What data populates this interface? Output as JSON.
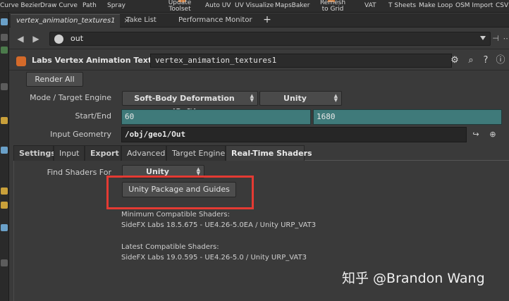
{
  "shelf": {
    "tools": [
      {
        "label": "Curve Bezier"
      },
      {
        "label": "Draw Curve"
      },
      {
        "label": "Path"
      },
      {
        "label": "Spray"
      },
      {
        "label": "Update Toolset"
      },
      {
        "label": "Auto UV"
      },
      {
        "label": "UV Visualize"
      },
      {
        "label": "MapsBaker"
      },
      {
        "label": "Remesh to Grid"
      },
      {
        "label": "VAT"
      },
      {
        "label": "T Sheets"
      },
      {
        "label": "Make Loop"
      },
      {
        "label": "OSM Import"
      },
      {
        "label": "CSV"
      }
    ]
  },
  "tabs": [
    {
      "label": "vertex_animation_textures1",
      "active": true,
      "close": "×"
    },
    {
      "label": "Take List"
    },
    {
      "label": "Performance Monitor"
    }
  ],
  "tab_add": "+",
  "pathbar": {
    "value": "out"
  },
  "node": {
    "type_label": "Labs Vertex Animation Textures",
    "name": "vertex_animation_textures1"
  },
  "params": {
    "render_all": "Render All",
    "mode_label": "Mode / Target Engine",
    "mode_value": "Soft-Body Deformation (Soft)",
    "engine_value": "Unity",
    "startend_label": "Start/End",
    "start": "60",
    "end": "1680",
    "input_geo_label": "Input Geometry",
    "input_geo_value": "/obj/geo1/Out"
  },
  "folders": [
    "Settings",
    "Input",
    "Export",
    "Advanced",
    "Target Engine",
    "Real-Time Shaders"
  ],
  "shaders": {
    "find_label": "Find Shaders For",
    "find_value": "Unity",
    "guides_button": "Unity Package and Guides",
    "min_heading": "Minimum Compatible Shaders:",
    "min_value": "SideFX Labs 18.5.675  -  UE4.26-5.0EA / Unity URP_VAT3",
    "latest_heading": "Latest Compatible Shaders:",
    "latest_value": "SideFX Labs 19.0.595  -  UE4.26-5.0 / Unity URP_VAT3"
  },
  "watermark": "知乎 @Brandon Wang",
  "colors": {
    "accent_orange": "#d46a2a",
    "number_field_teal": "#3f7a7a",
    "highlight_red": "#e43a33"
  },
  "icons": [
    "gear-icon",
    "search-icon",
    "help-icon",
    "info-icon",
    "globe-icon",
    "pin-icon",
    "back-arrow-icon",
    "forward-arrow-icon"
  ]
}
